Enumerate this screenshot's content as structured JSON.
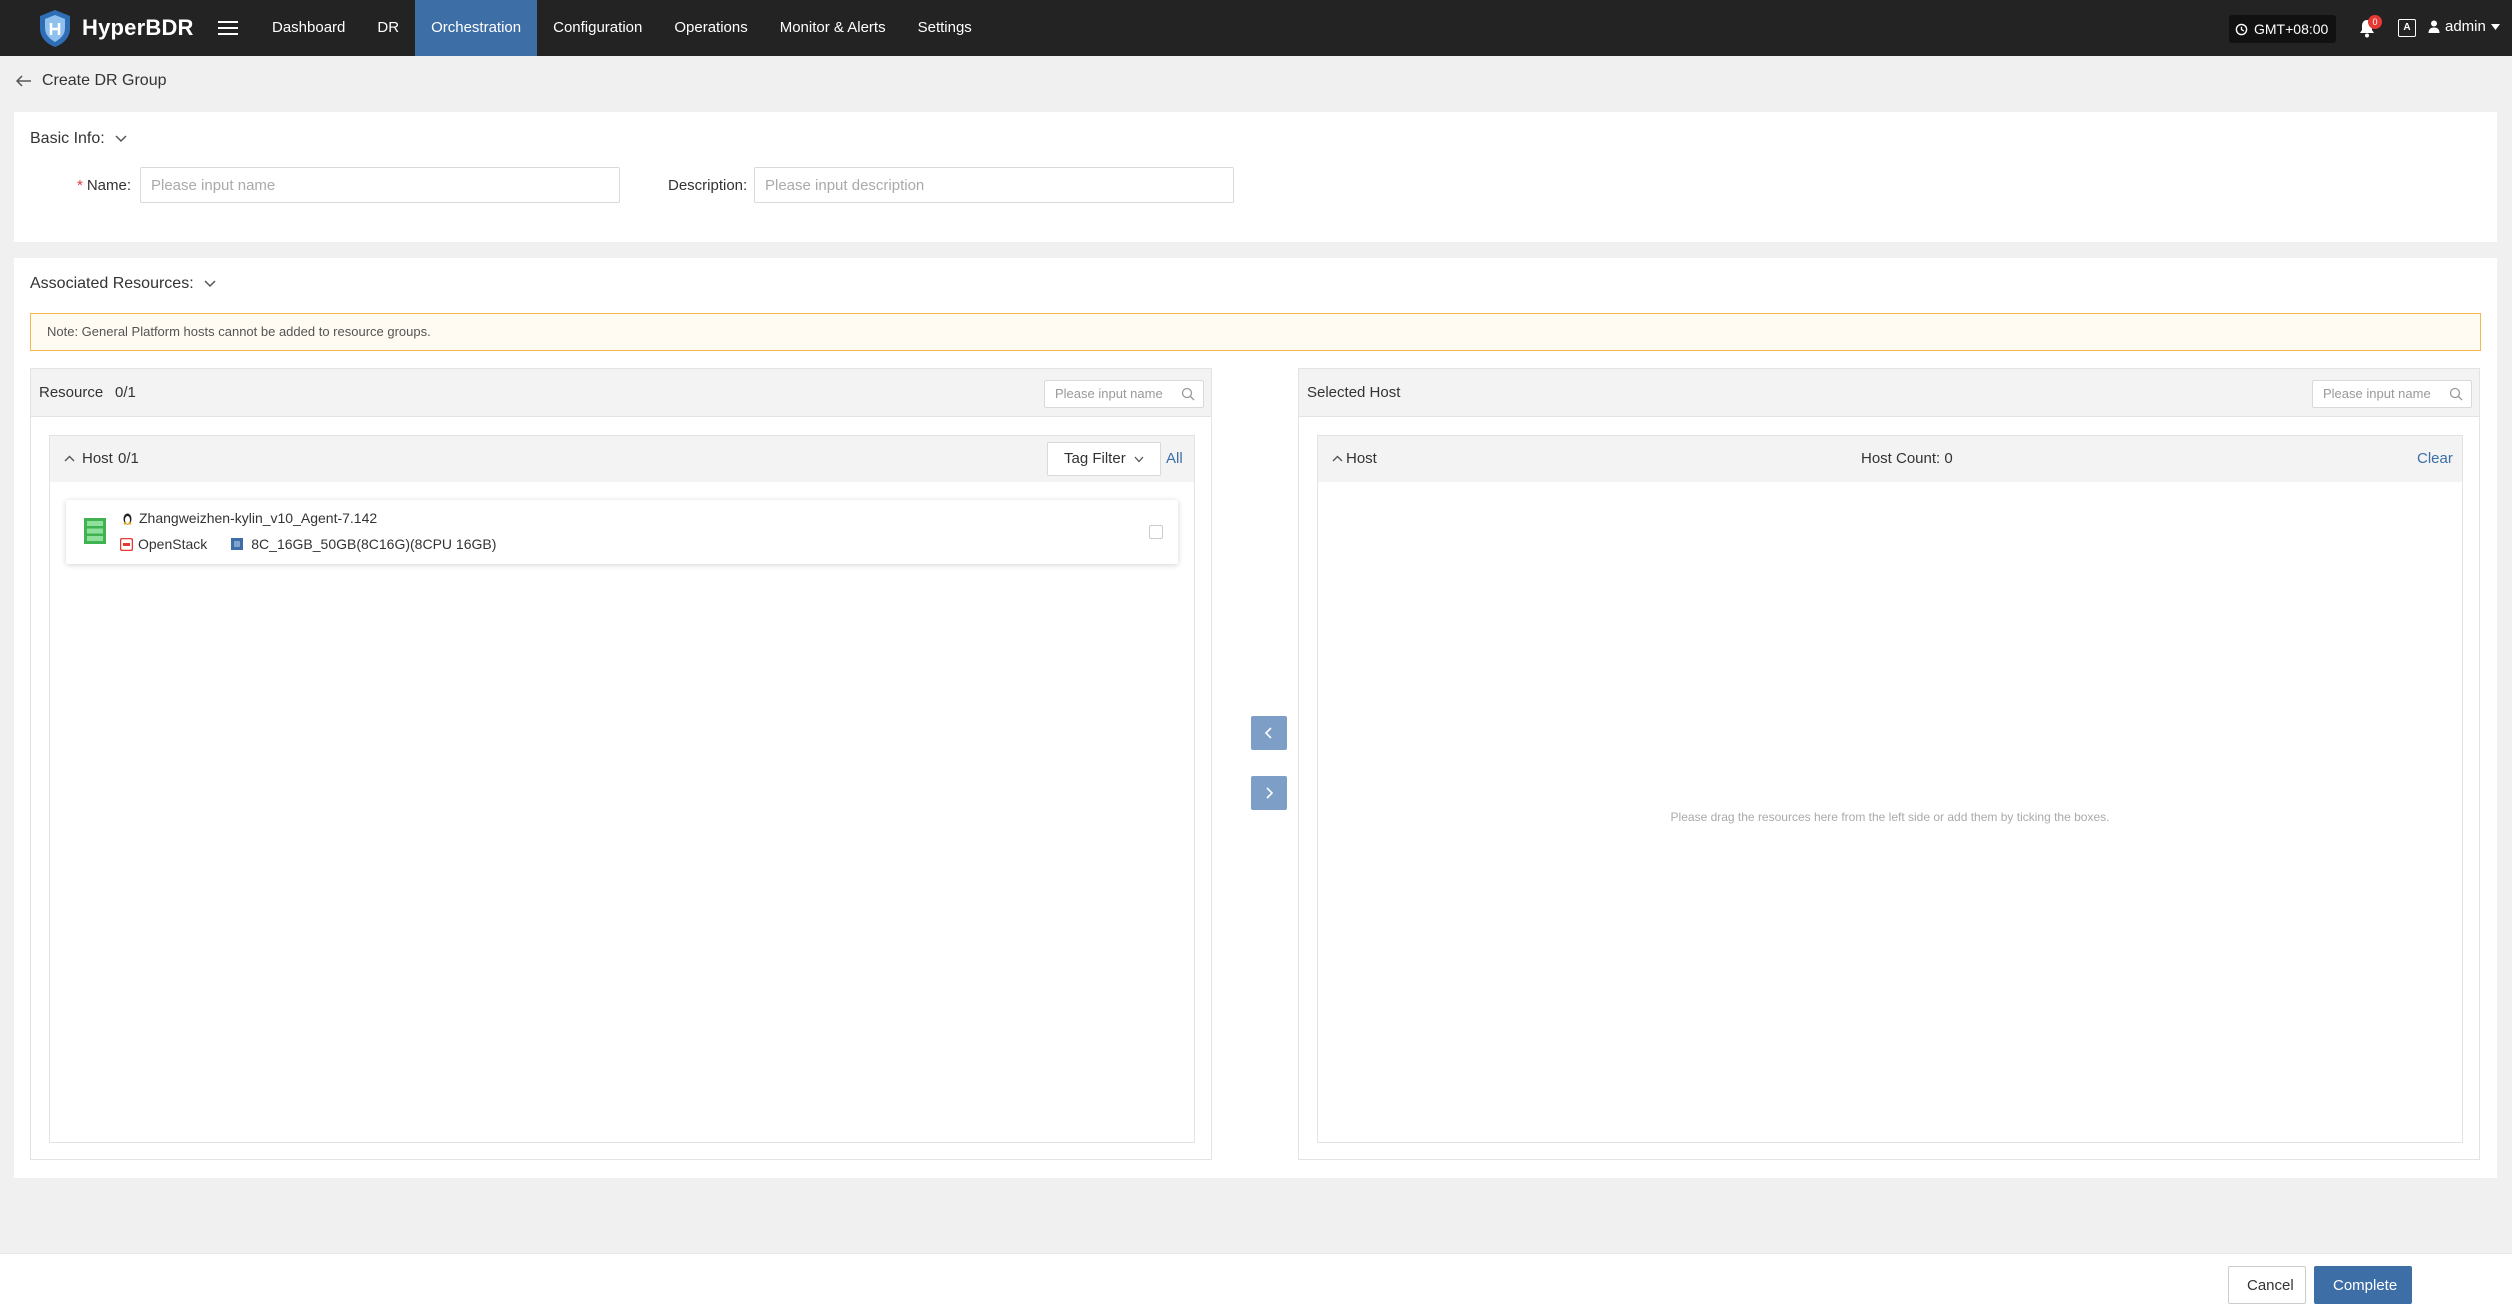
{
  "app": {
    "brand": "HyperBDR"
  },
  "nav": {
    "items": [
      {
        "label": "Dashboard",
        "active": false
      },
      {
        "label": "DR",
        "active": false
      },
      {
        "label": "Orchestration",
        "active": true
      },
      {
        "label": "Configuration",
        "active": false
      },
      {
        "label": "Operations",
        "active": false
      },
      {
        "label": "Monitor & Alerts",
        "active": false
      },
      {
        "label": "Settings",
        "active": false
      }
    ],
    "timezone": "GMT+08:00",
    "notification_count": "0",
    "lang_icon_text": "A",
    "user": "admin"
  },
  "page": {
    "title": "Create DR Group"
  },
  "basic": {
    "section_title": "Basic Info:",
    "name_label": "Name:",
    "name_required": "*",
    "name_placeholder": "Please input name",
    "name_value": "",
    "desc_label": "Description:",
    "desc_placeholder": "Please input description",
    "desc_value": ""
  },
  "assoc": {
    "section_title": "Associated Resources:",
    "note": "Note: General Platform hosts cannot be added to resource groups.",
    "left": {
      "title": "Resource",
      "count": "0/1",
      "search_placeholder": "Please input name",
      "group_title": "Host",
      "group_count": "0/1",
      "tag_filter": "Tag Filter",
      "all_link": "All",
      "hosts": [
        {
          "name": "Zhangweizhen-kylin_v10_Agent-7.142",
          "platform": "OpenStack",
          "flavor": "8C_16GB_50GB(8C16G)(8CPU 16GB)",
          "checked": false
        }
      ]
    },
    "right": {
      "title": "Selected Host",
      "search_placeholder": "Please input name",
      "group_title": "Host",
      "host_count": "Host Count: 0",
      "clear": "Clear",
      "empty": "Please drag the resources here from the left side or add them by ticking the boxes."
    }
  },
  "footer": {
    "cancel": "Cancel",
    "complete": "Complete"
  },
  "colors": {
    "accent": "#3d6ea5",
    "topbar": "#232323",
    "warning_border": "#f5b74f"
  }
}
